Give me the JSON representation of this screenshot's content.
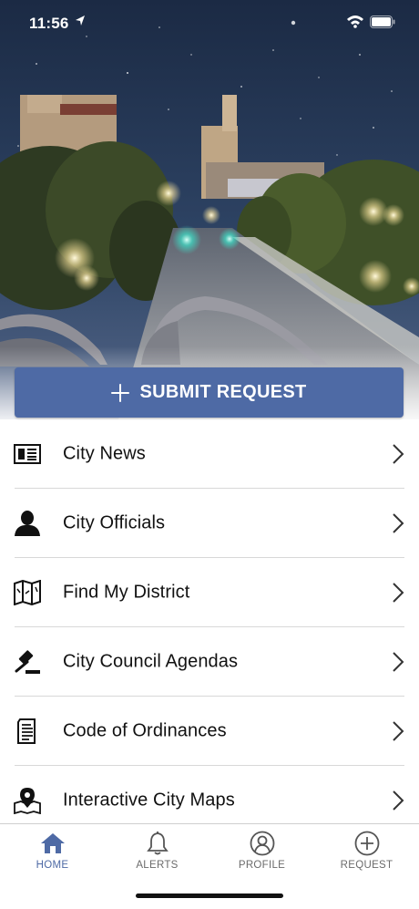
{
  "status_bar": {
    "time": "11:56"
  },
  "hero": {
    "submit_label": "SUBMIT REQUEST"
  },
  "menu": {
    "items": [
      {
        "label": "City News",
        "icon": "newspaper-icon"
      },
      {
        "label": "City Officials",
        "icon": "person-icon"
      },
      {
        "label": "Find My District",
        "icon": "folded-map-icon"
      },
      {
        "label": "City Council Agendas",
        "icon": "gavel-icon"
      },
      {
        "label": "Code of Ordinances",
        "icon": "document-icon"
      },
      {
        "label": "Interactive City Maps",
        "icon": "map-pin-icon"
      }
    ]
  },
  "tabbar": {
    "tabs": [
      {
        "label": "HOME",
        "icon": "home-icon",
        "active": true
      },
      {
        "label": "ALERTS",
        "icon": "bell-icon",
        "active": false
      },
      {
        "label": "PROFILE",
        "icon": "profile-icon",
        "active": false
      },
      {
        "label": "REQUEST",
        "icon": "add-circle-icon",
        "active": false
      }
    ]
  },
  "colors": {
    "accent": "#4e6aa5",
    "text": "#111111",
    "tab_inactive": "#6b6b6b"
  }
}
